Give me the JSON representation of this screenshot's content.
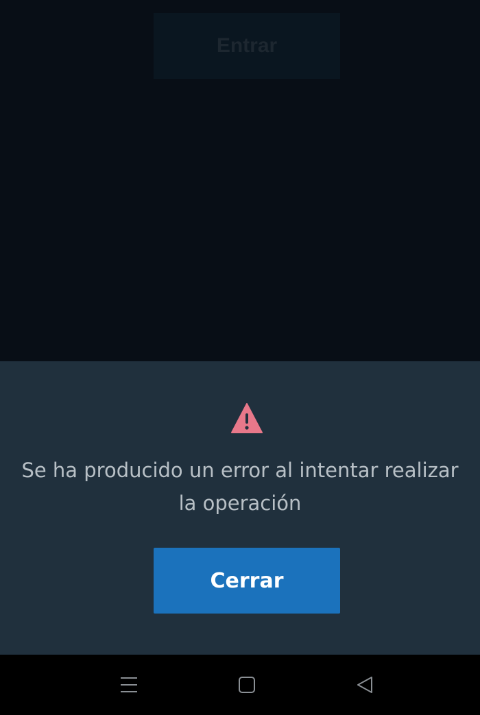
{
  "background": {
    "login_button_label": "Entrar"
  },
  "dialog": {
    "icon": "warning-icon",
    "icon_color": "#e8788a",
    "message": "Se ha producido un error al intentar realizar la operación",
    "close_label": "Cerrar",
    "accent": "#1b72bc"
  },
  "navbar": {
    "items": [
      "menu-icon",
      "home-icon",
      "back-icon"
    ]
  }
}
